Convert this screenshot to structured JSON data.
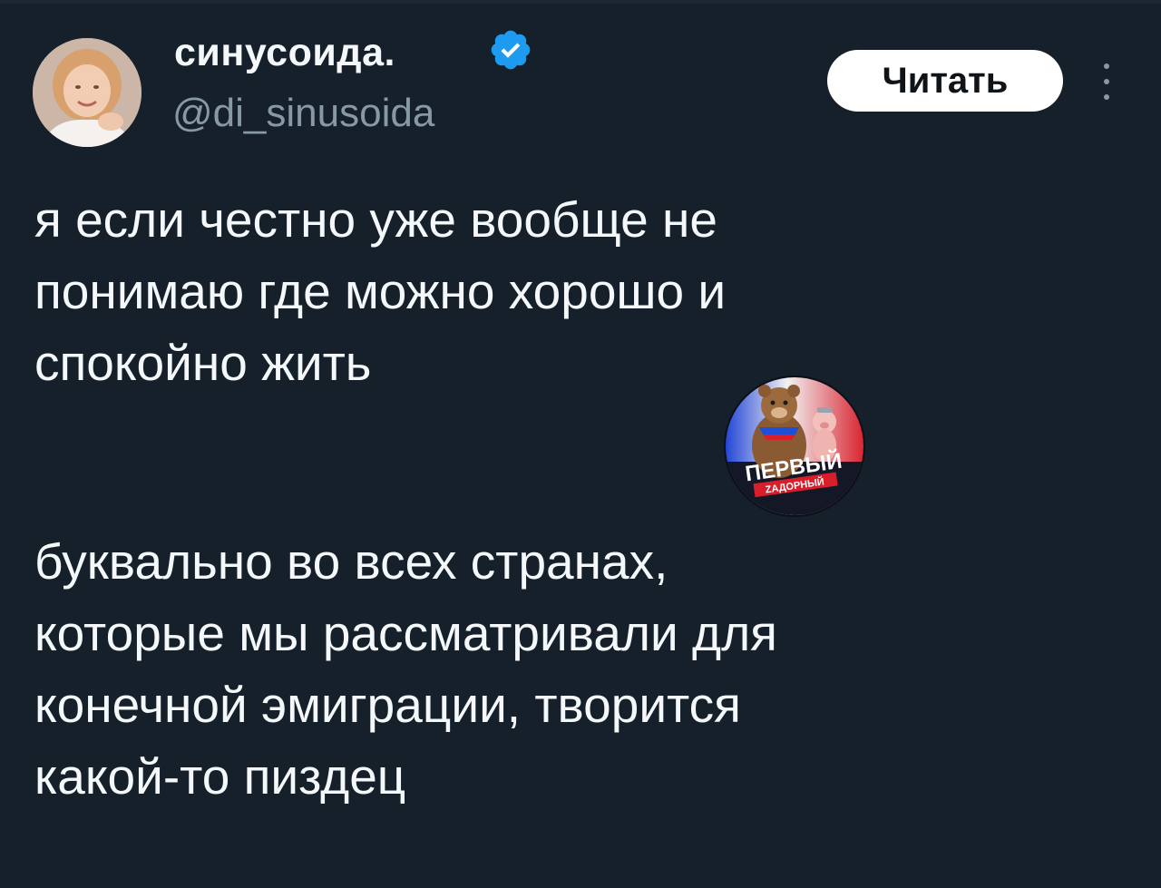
{
  "tweet": {
    "author": {
      "display_name": "синусоида.",
      "handle": "@di_sinusoida",
      "verified": true,
      "avatar_icon": "profile-photo"
    },
    "follow_label": "Читать",
    "more_icon": "vertical-dots-icon",
    "paragraphs": [
      "я если честно уже вообще не\nпонимаю где можно хорошо и\nспокойно жить",
      "буквально во всех странах,\nкоторые мы рассматривали для\nконечной эмиграции, творится\nкакой-то пиздец"
    ]
  },
  "watermark": {
    "line1": "ПЕРВЫЙ",
    "line2": "ZАДОРНЫЙ"
  },
  "colors": {
    "background": "#15202b",
    "text": "#f5f8fa",
    "muted": "#8899a6",
    "verified": "#1d9bf0",
    "button_bg": "#ffffff"
  }
}
